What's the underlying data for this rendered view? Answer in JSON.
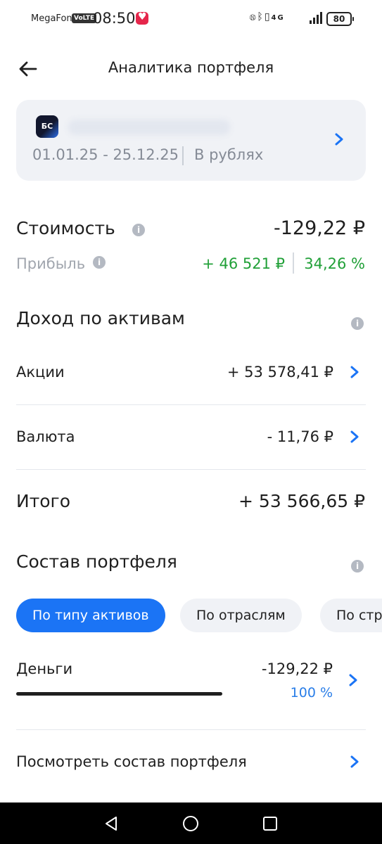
{
  "status_bar": {
    "carrier": "MegaFon",
    "volte": "VoLTE",
    "time": "08:50",
    "network": "4G",
    "battery": "80"
  },
  "header": {
    "title": "Аналитика портфеля"
  },
  "account_card": {
    "logo_text": "БС",
    "period": "01.01.25 - 25.12.25",
    "currency": "В рублях"
  },
  "value": {
    "label": "Стоимость",
    "amount": "-129,22 ₽",
    "profit_label": "Прибыль",
    "profit_abs": "+ 46 521 ₽",
    "profit_pct": "34,26 %",
    "profit_color": "#21a038"
  },
  "income": {
    "title": "Доход по активам",
    "rows": [
      {
        "label": "Акции",
        "value": "+ 53 578,41 ₽"
      },
      {
        "label": "Валюта",
        "value": "- 11,76 ₽"
      }
    ],
    "total_label": "Итого",
    "total_value": "+ 53 566,65 ₽"
  },
  "composition": {
    "title": "Состав портфеля",
    "chips": [
      {
        "label": "По типу активов",
        "active": true
      },
      {
        "label": "По отраслям",
        "active": false
      },
      {
        "label": "По стр",
        "active": false
      }
    ],
    "items": [
      {
        "label": "Деньги",
        "value": "-129,22 ₽",
        "percent": "100 %",
        "share": 1.0
      }
    ],
    "view_link": "Посмотреть состав портфеля"
  },
  "colors": {
    "accent": "#1b74f5",
    "positive": "#21a038",
    "card_bg": "#f0f2f6"
  }
}
